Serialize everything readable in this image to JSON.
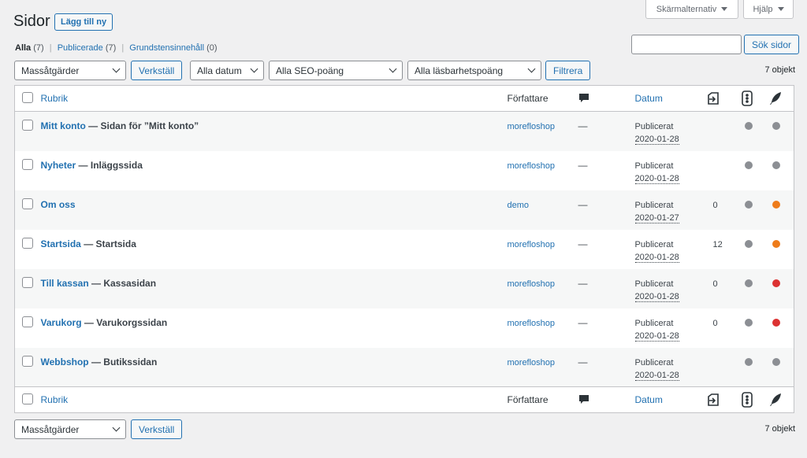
{
  "header": {
    "title": "Sidor",
    "add_new_label": "Lägg till ny",
    "screen_options_label": "Skärmalternativ",
    "help_label": "Hjälp"
  },
  "views": {
    "all_label": "Alla",
    "all_count": "(7)",
    "published_label": "Publicerade",
    "published_count": "(7)",
    "cornerstone_label": "Grundstensinnehåll",
    "cornerstone_count": "(0)"
  },
  "search": {
    "value": "",
    "button_label": "Sök sidor"
  },
  "filters": {
    "bulk_actions": "Massåtgärder",
    "apply_label": "Verkställ",
    "dates": "Alla datum",
    "seo": "Alla SEO-poäng",
    "readability": "Alla läsbarhetspoäng",
    "filter_label": "Filtrera",
    "items_count": "7 objekt"
  },
  "columns": {
    "title": "Rubrik",
    "author": "Författare",
    "date": "Datum"
  },
  "colors": {
    "grey": "#8c8f94",
    "orange": "#ee7c1b",
    "red": "#dc3232"
  },
  "rows": [
    {
      "title": "Mitt konto",
      "state": " — Sidan för ”Mitt konto”",
      "author": "morefloshop",
      "comments": "—",
      "status": "Publicerat",
      "date": "2020-01-28",
      "links": "",
      "seo": "#8c8f94",
      "read": "#8c8f94"
    },
    {
      "title": "Nyheter",
      "state": " — Inläggssida",
      "author": "morefloshop",
      "comments": "—",
      "status": "Publicerat",
      "date": "2020-01-28",
      "links": "",
      "seo": "#8c8f94",
      "read": "#8c8f94"
    },
    {
      "title": "Om oss",
      "state": "",
      "author": "demo",
      "comments": "—",
      "status": "Publicerat",
      "date": "2020-01-27",
      "links": "0",
      "seo": "#8c8f94",
      "read": "#ee7c1b"
    },
    {
      "title": "Startsida",
      "state": " — Startsida",
      "author": "morefloshop",
      "comments": "—",
      "status": "Publicerat",
      "date": "2020-01-28",
      "links": "12",
      "seo": "#8c8f94",
      "read": "#ee7c1b"
    },
    {
      "title": "Till kassan",
      "state": " — Kassasidan",
      "author": "morefloshop",
      "comments": "—",
      "status": "Publicerat",
      "date": "2020-01-28",
      "links": "0",
      "seo": "#8c8f94",
      "read": "#dc3232"
    },
    {
      "title": "Varukorg",
      "state": " — Varukorgssidan",
      "author": "morefloshop",
      "comments": "—",
      "status": "Publicerat",
      "date": "2020-01-28",
      "links": "0",
      "seo": "#8c8f94",
      "read": "#dc3232"
    },
    {
      "title": "Webbshop",
      "state": " — Butikssidan",
      "author": "morefloshop",
      "comments": "—",
      "status": "Publicerat",
      "date": "2020-01-28",
      "links": "",
      "seo": "#8c8f94",
      "read": "#8c8f94"
    }
  ]
}
